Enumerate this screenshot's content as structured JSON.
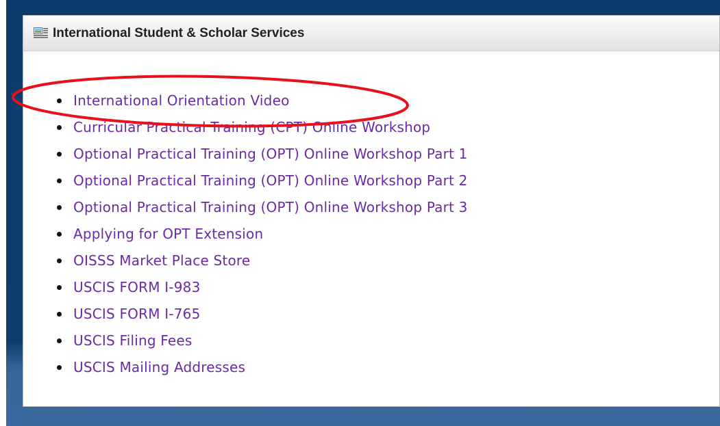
{
  "portlet": {
    "title": "International Student & Scholar Services",
    "icon": "news-icon"
  },
  "links": [
    "International Orientation Video",
    "Curricular Practical Training (CPT) Online Workshop",
    "Optional Practical Training (OPT) Online Workshop Part 1",
    "Optional Practical Training (OPT) Online Workshop Part 2",
    "Optional Practical Training (OPT) Online Workshop Part 3",
    "Applying for OPT Extension",
    "OISSS Market Place Store",
    "USCIS FORM I-983",
    "USCIS FORM I-765",
    "USCIS Filing Fees",
    "USCIS Mailing Addresses"
  ],
  "colors": {
    "link": "#6a2aa6",
    "frame": "#0c3b6b",
    "annotation": "#e8101a"
  }
}
